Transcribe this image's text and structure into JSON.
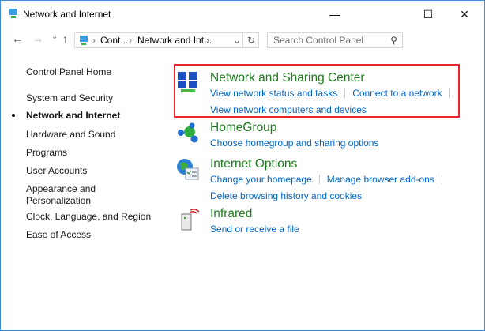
{
  "window": {
    "title": "Network and Internet",
    "minimize": "—",
    "maximize": "☐",
    "close": "✕"
  },
  "toolbar": {
    "back": "←",
    "forward": "→",
    "recent": "⌄",
    "up": "↑",
    "breadcrumb": [
      "Cont...",
      "Network and Int..."
    ],
    "sep": "›",
    "dropdown": "⌄",
    "refresh": "↻",
    "search_placeholder": "Search Control Panel",
    "search_icon": "⚲"
  },
  "sidebar": {
    "home": "Control Panel Home",
    "items": [
      "System and Security",
      "Network and Internet",
      "Hardware and Sound",
      "Programs",
      "User Accounts",
      "Appearance and Personalization",
      "Clock, Language, and Region",
      "Ease of Access"
    ],
    "active_index": 1
  },
  "categories": [
    {
      "title": "Network and Sharing Center",
      "links": [
        "View network status and tasks",
        "Connect to a network",
        "View network computers and devices"
      ]
    },
    {
      "title": "HomeGroup",
      "links": [
        "Choose homegroup and sharing options"
      ]
    },
    {
      "title": "Internet Options",
      "links": [
        "Change your homepage",
        "Manage browser add-ons",
        "Delete browsing history and cookies"
      ]
    },
    {
      "title": "Infrared",
      "links": [
        "Send or receive a file"
      ]
    }
  ],
  "colors": {
    "heading": "#1e7c1e",
    "link": "#0066cc",
    "highlight": "#e8262c"
  }
}
